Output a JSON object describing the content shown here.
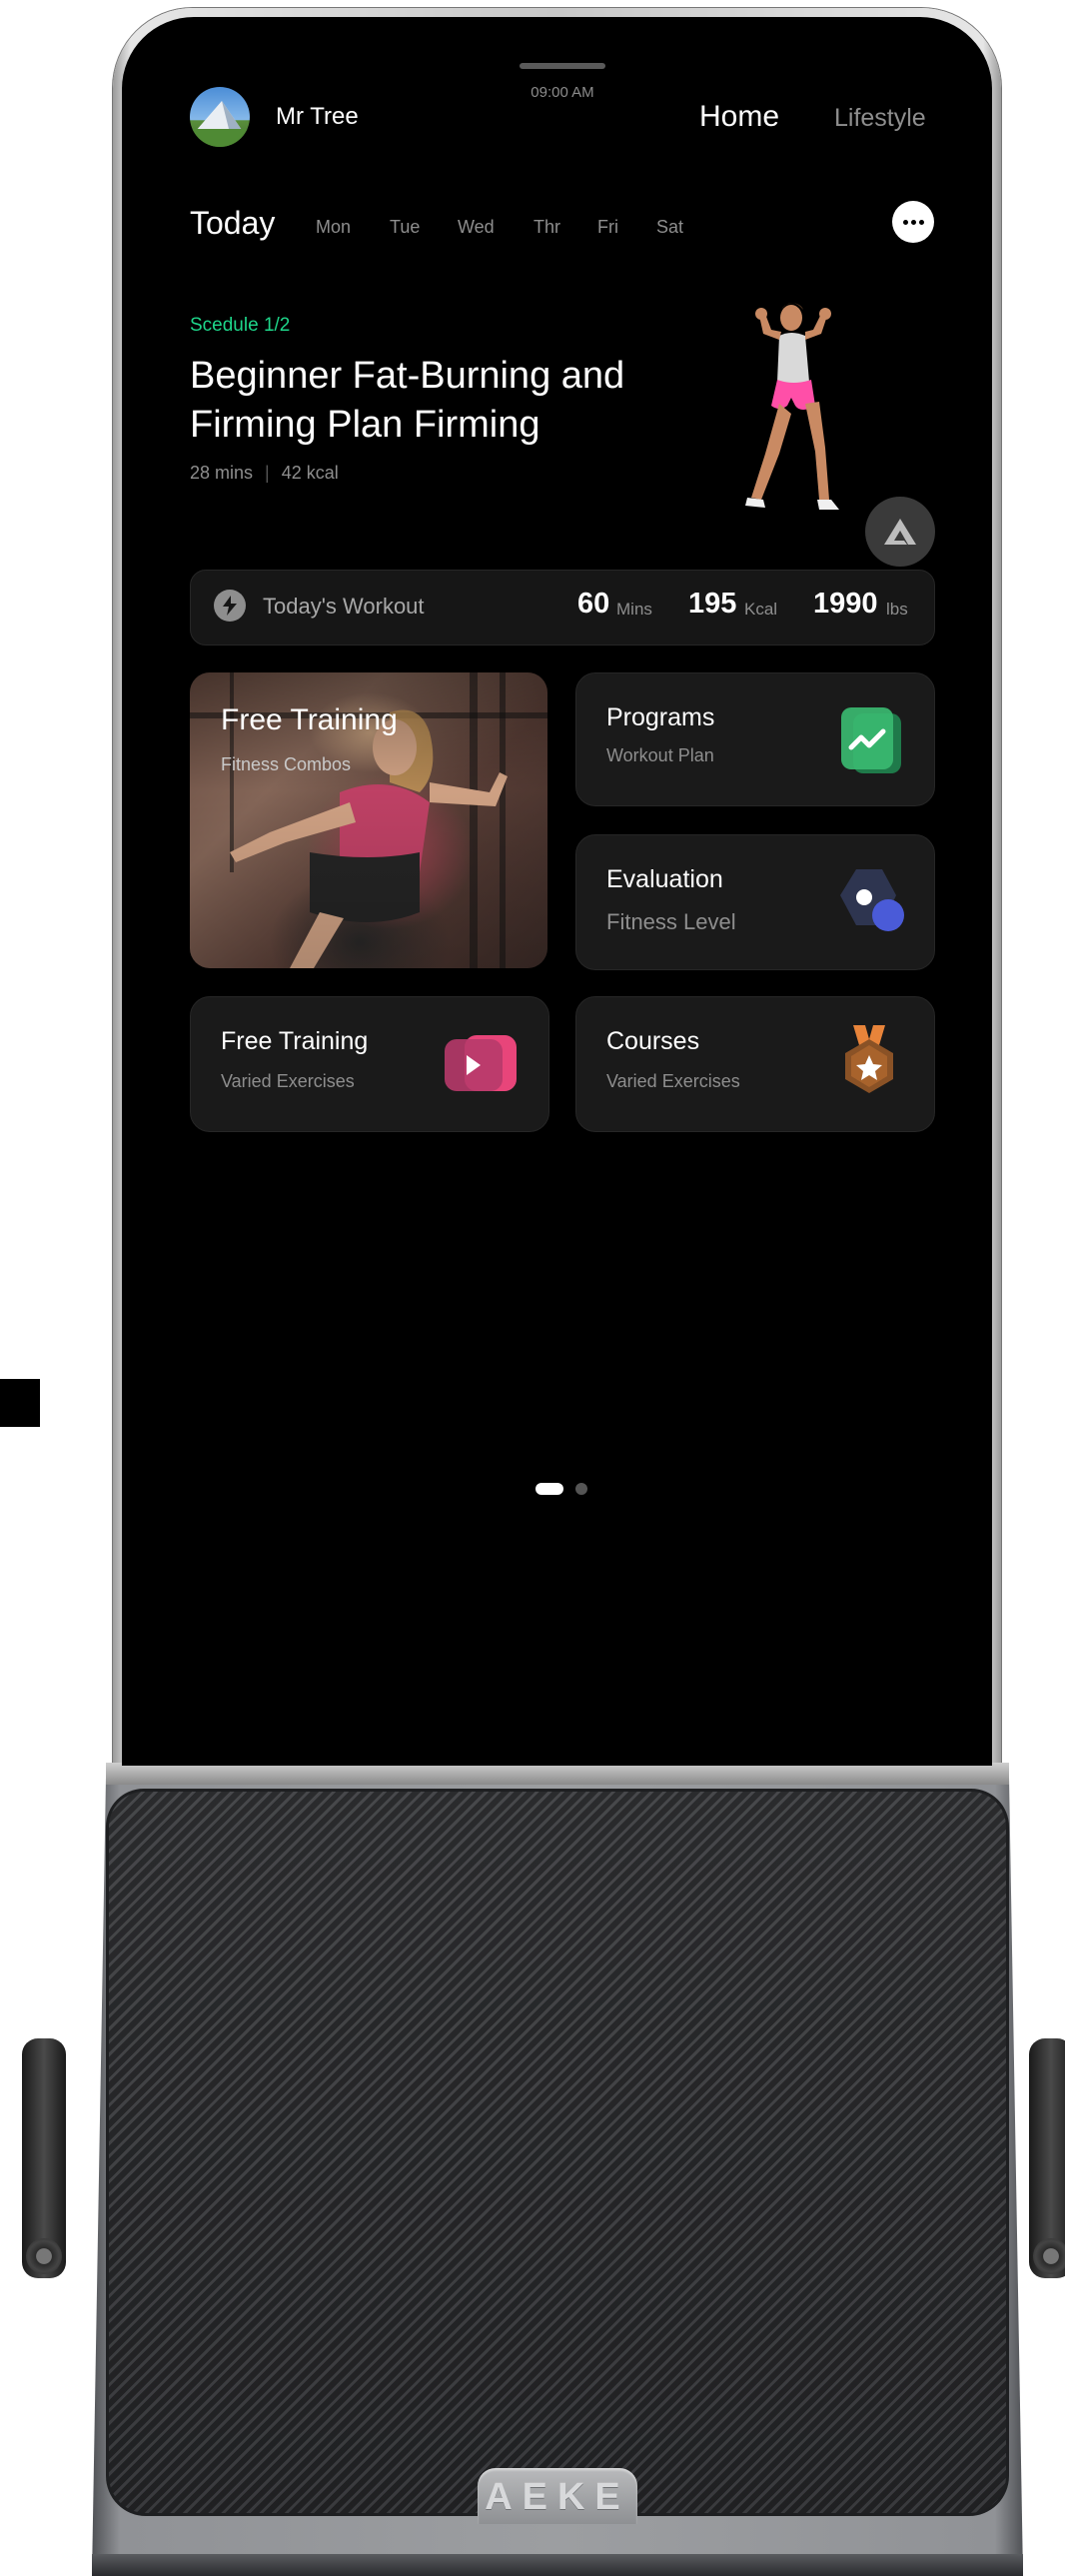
{
  "status": {
    "time": "09:00 AM"
  },
  "header": {
    "user_name": "Mr Tree",
    "nav": [
      {
        "label": "Home",
        "active": true
      },
      {
        "label": "Lifestyle",
        "active": false
      }
    ]
  },
  "week": {
    "today_label": "Today",
    "days": [
      "Mon",
      "Tue",
      "Wed",
      "Thr",
      "Fri",
      "Sat"
    ]
  },
  "plan": {
    "schedule": "Scedule 1/2",
    "title": "Beginner Fat-Burning and Firming Plan Firming",
    "duration": "28 mins",
    "calories": "42 kcal"
  },
  "workout": {
    "label": "Today's Workout",
    "stats": [
      {
        "value": "60",
        "unit": "Mins"
      },
      {
        "value": "195",
        "unit": "Kcal"
      },
      {
        "value": "1990",
        "unit": "lbs"
      }
    ]
  },
  "cards": {
    "featured": {
      "title": "Free Training",
      "subtitle": "Fitness Combos"
    },
    "programs": {
      "title": "Programs",
      "subtitle": "Workout Plan",
      "icon": "chart-trend-icon",
      "color": "#2fa866"
    },
    "evaluation": {
      "title": "Evaluation",
      "subtitle": "Fitness Level",
      "icon": "hexagon-dot-icon",
      "color": "#4a5bd8"
    },
    "free_training": {
      "title": "Free Training",
      "subtitle": "Varied Exercises",
      "icon": "play-icon",
      "color": "#e8457a"
    },
    "courses": {
      "title": "Courses",
      "subtitle": "Varied Exercises",
      "icon": "medal-star-icon",
      "color": "#e8843a"
    }
  },
  "pager": {
    "pages": 2,
    "current": 1
  },
  "hardware": {
    "brand": "AEKE"
  },
  "theme": {
    "accent": "#1ed68a",
    "background": "#000000"
  }
}
